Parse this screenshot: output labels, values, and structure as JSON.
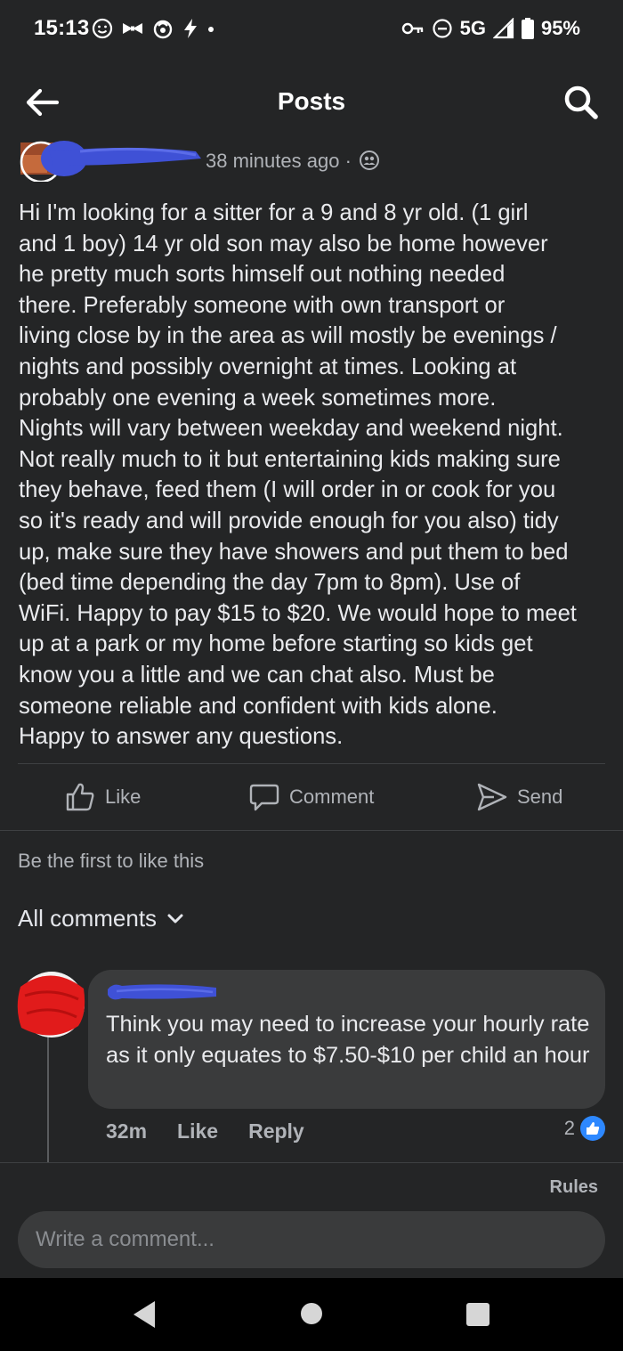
{
  "status_bar": {
    "time": "15:13",
    "network": "5G",
    "battery": "95%"
  },
  "appbar": {
    "title": "Posts",
    "back_icon": "arrow-left-icon",
    "search_icon": "search-icon"
  },
  "post": {
    "time": "38 minutes ago",
    "separator": "·",
    "audience_icon": "group-icon",
    "body": "Hi I'm looking for a sitter for a 9 and 8 yr old. (1 girl\nand 1 boy) 14 yr old son may also be home however\nhe pretty much sorts himself out nothing needed\nthere.  Preferably someone with own transport or\nliving close by in the area as will mostly be evenings /\nnights and possibly overnight at times. Looking at\nprobably one evening a week  sometimes more.\nNights will vary between weekday and weekend night.\nNot really much to it but entertaining kids making sure\nthey behave, feed them (I will order in or cook for you\nso it's ready and will provide enough for you also) tidy\nup, make sure they have showers and put them to bed\n(bed time depending the day 7pm to 8pm). Use of\nWiFi. Happy to pay $15 to $20. We would hope to meet\nup at a park or my home before starting so kids get\nknow you a little and we can chat also. Must be\nsomeone reliable and confident with kids alone.\nHappy to answer any questions."
  },
  "actions": {
    "like": "Like",
    "comment": "Comment",
    "send": "Send"
  },
  "reactions_summary": "Be the first to like this",
  "comments_filter": "All comments",
  "comment": {
    "text": "Think you may need to increase your hourly rate as it only equates to $7.50-$10 per child an hour",
    "time": "32m",
    "like_label": "Like",
    "reply_label": "Reply",
    "reaction_count": "2"
  },
  "footer": {
    "rules": "Rules",
    "input_placeholder": "Write a comment..."
  },
  "colors": {
    "background": "#242526",
    "bubble": "#3a3b3c",
    "accent_blue": "#2d88ff",
    "scribble_blue": "#3f51d6",
    "scribble_red": "#e11b1b"
  }
}
